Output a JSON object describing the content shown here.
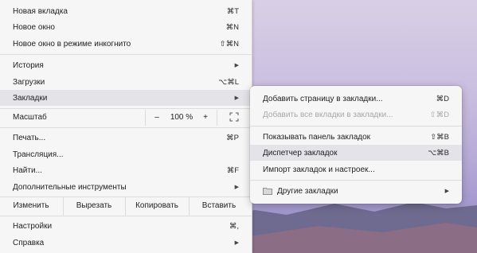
{
  "menu": {
    "new_tab": {
      "label": "Новая вкладка",
      "shortcut": "⌘T"
    },
    "new_window": {
      "label": "Новое окно",
      "shortcut": "⌘N"
    },
    "incognito": {
      "label": "Новое окно в режиме инкогнито",
      "shortcut": "⇧⌘N"
    },
    "history": {
      "label": "История"
    },
    "downloads": {
      "label": "Загрузки",
      "shortcut": "⌥⌘L"
    },
    "bookmarks": {
      "label": "Закладки"
    },
    "zoom": {
      "label": "Масштаб",
      "minus": "–",
      "value": "100 %",
      "plus": "+"
    },
    "print": {
      "label": "Печать...",
      "shortcut": "⌘P"
    },
    "cast": {
      "label": "Трансляция..."
    },
    "find": {
      "label": "Найти...",
      "shortcut": "⌘F"
    },
    "more_tools": {
      "label": "Дополнительные инструменты"
    },
    "edit": {
      "label": "Изменить",
      "cut": "Вырезать",
      "copy": "Копировать",
      "paste": "Вставить"
    },
    "settings": {
      "label": "Настройки",
      "shortcut": "⌘,"
    },
    "help": {
      "label": "Справка"
    }
  },
  "bookmarks_submenu": {
    "add_page": {
      "label": "Добавить страницу в закладки...",
      "shortcut": "⌘D"
    },
    "add_all": {
      "label": "Добавить все вкладки в закладки...",
      "shortcut": "⇧⌘D"
    },
    "show_bar": {
      "label": "Показывать панель закладок",
      "shortcut": "⇧⌘B"
    },
    "manager": {
      "label": "Диспетчер закладок",
      "shortcut": "⌥⌘B"
    },
    "import": {
      "label": "Импорт закладок и настроек..."
    },
    "other": {
      "label": "Другие закладки"
    }
  }
}
